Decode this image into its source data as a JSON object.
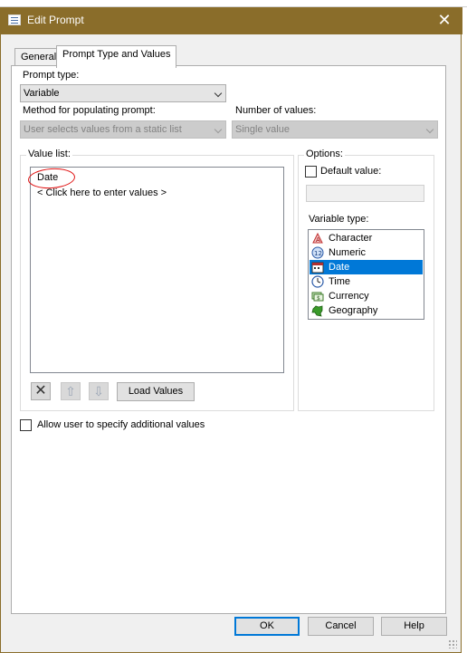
{
  "window": {
    "title": "Edit Prompt",
    "close_glyph": "✕"
  },
  "tabs": [
    {
      "label": "General",
      "active": false
    },
    {
      "label": "Prompt Type and Values",
      "active": true
    }
  ],
  "prompt_type": {
    "label": "Prompt type:",
    "value": "Variable"
  },
  "method": {
    "label": "Method for populating prompt:",
    "value": "User selects values from a static list"
  },
  "number_of_values": {
    "label": "Number of values:",
    "value": "Single value"
  },
  "value_list": {
    "label": "Value list:",
    "items": [
      "Date",
      "< Click here to enter values >"
    ],
    "load_values_label": "Load Values"
  },
  "options": {
    "label": "Options:",
    "default_value_label": "Default value:",
    "default_value_checked": false,
    "variable_type_label": "Variable type:",
    "variable_types": [
      {
        "label": "Character",
        "icon": "character-icon",
        "selected": false
      },
      {
        "label": "Numeric",
        "icon": "numeric-icon",
        "selected": false
      },
      {
        "label": "Date",
        "icon": "date-icon",
        "selected": true
      },
      {
        "label": "Time",
        "icon": "time-icon",
        "selected": false
      },
      {
        "label": "Currency",
        "icon": "currency-icon",
        "selected": false
      },
      {
        "label": "Geography",
        "icon": "geography-icon",
        "selected": false
      }
    ]
  },
  "allow_additional": {
    "label": "Allow user to specify additional values",
    "checked": false
  },
  "footer": {
    "ok": "OK",
    "cancel": "Cancel",
    "help": "Help"
  },
  "colors": {
    "titlebar": "#8a6d2a",
    "selection": "#0078d7",
    "annotation": "#e01010"
  }
}
